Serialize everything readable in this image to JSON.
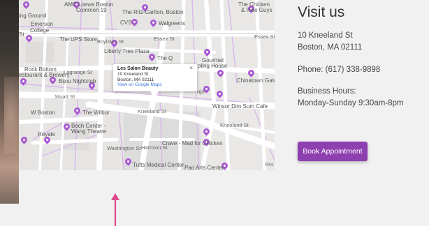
{
  "info": {
    "heading": "Visit us",
    "address_line1": "10 Kneeland St",
    "address_line2": "Boston, MA 02111",
    "phone": "Phone: (617) 338-9898",
    "hours_label": "Business Hours:",
    "hours_value": "Monday-Sunday 9:30am-8pm",
    "book_button_label": "Book Appointment"
  },
  "map": {
    "infowindow": {
      "title": "Les Salon Beauty",
      "line1": "10 Kneeland St",
      "line2": "Boston, MA 02111",
      "link": "View on Google Maps",
      "close": "×"
    },
    "labels": {
      "amc": "AMC Loews Boston",
      "amc2": "Common 19",
      "ritz": "The Ritz-Carlton, Boston",
      "chicken": "The Chicken",
      "chicken2": "& Rice Guys",
      "ground": "ing Ground",
      "cvs": "CVS",
      "walgreens": "Walgreens",
      "emerson": "Emerson",
      "college": "College",
      "st": "St",
      "ups": "The UPS Store",
      "boylston": "Boylston St",
      "essex": "Essex St",
      "essex2": "Essex St",
      "liberty": "Liberty Tree Plaza",
      "theq": "The Q",
      "gourmet": "Gourmet",
      "dumpling": "pling House",
      "rockbottom": "Rock Bottom",
      "rockbottom2": "estaurant & Brewery",
      "bijou": "Bijou Nightclub",
      "lagrange": "Lagrange St",
      "chinatown": "Chinatown Gate",
      "stuart": "Stuart St",
      "hojo": "ojo",
      "kneeland": "Kneeland St",
      "winsor": "Winsor Dim Sum Cafe",
      "wboston": "W Boston",
      "wilbur": "The Wilbur",
      "boch": "Boch Center -",
      "boch2": "Wang Theatre",
      "royale": "Royale",
      "kneeland2": "Kneeland St",
      "harrison": "Harrison St",
      "crave": "Crave - Mad for Chicken",
      "washington": "Washington St",
      "tufts": "Tufts Medical Center",
      "paoarts": "Pao Arts Center",
      "res": "Res"
    }
  },
  "colors": {
    "accent": "#8e3fb0",
    "pin": "#a85bd1"
  }
}
